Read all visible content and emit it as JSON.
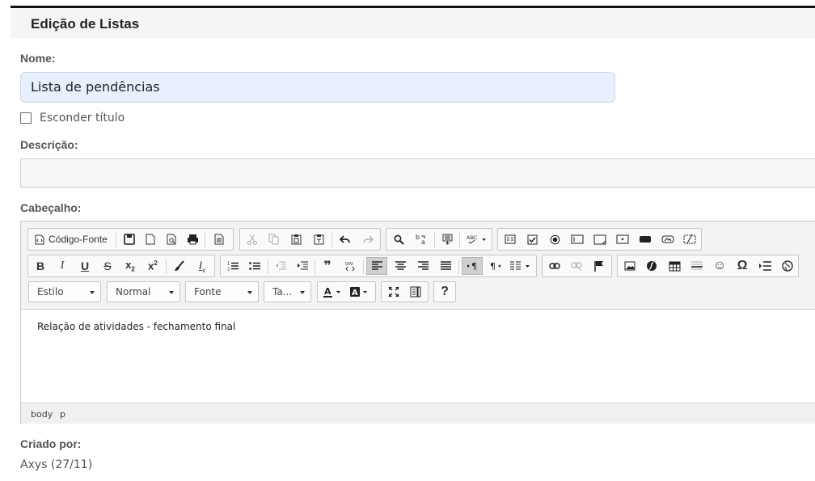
{
  "header": {
    "title": "Edição de Listas"
  },
  "form": {
    "name_label": "Nome:",
    "name_value": "Lista de pendências",
    "hide_title_label": "Esconder título",
    "description_label": "Descrição:",
    "description_value": "",
    "header_label": "Cabeçalho:",
    "created_by_label": "Criado por:",
    "created_by_value": "Axys (27/11)"
  },
  "editor": {
    "source_button": "Código-Fonte",
    "combos": {
      "style": "Estilo",
      "format": "Normal",
      "font": "Fonte",
      "size": "Ta..."
    },
    "help_label": "?",
    "content": "Relação de atividades - fechamento final",
    "path": [
      "body",
      "p"
    ]
  }
}
